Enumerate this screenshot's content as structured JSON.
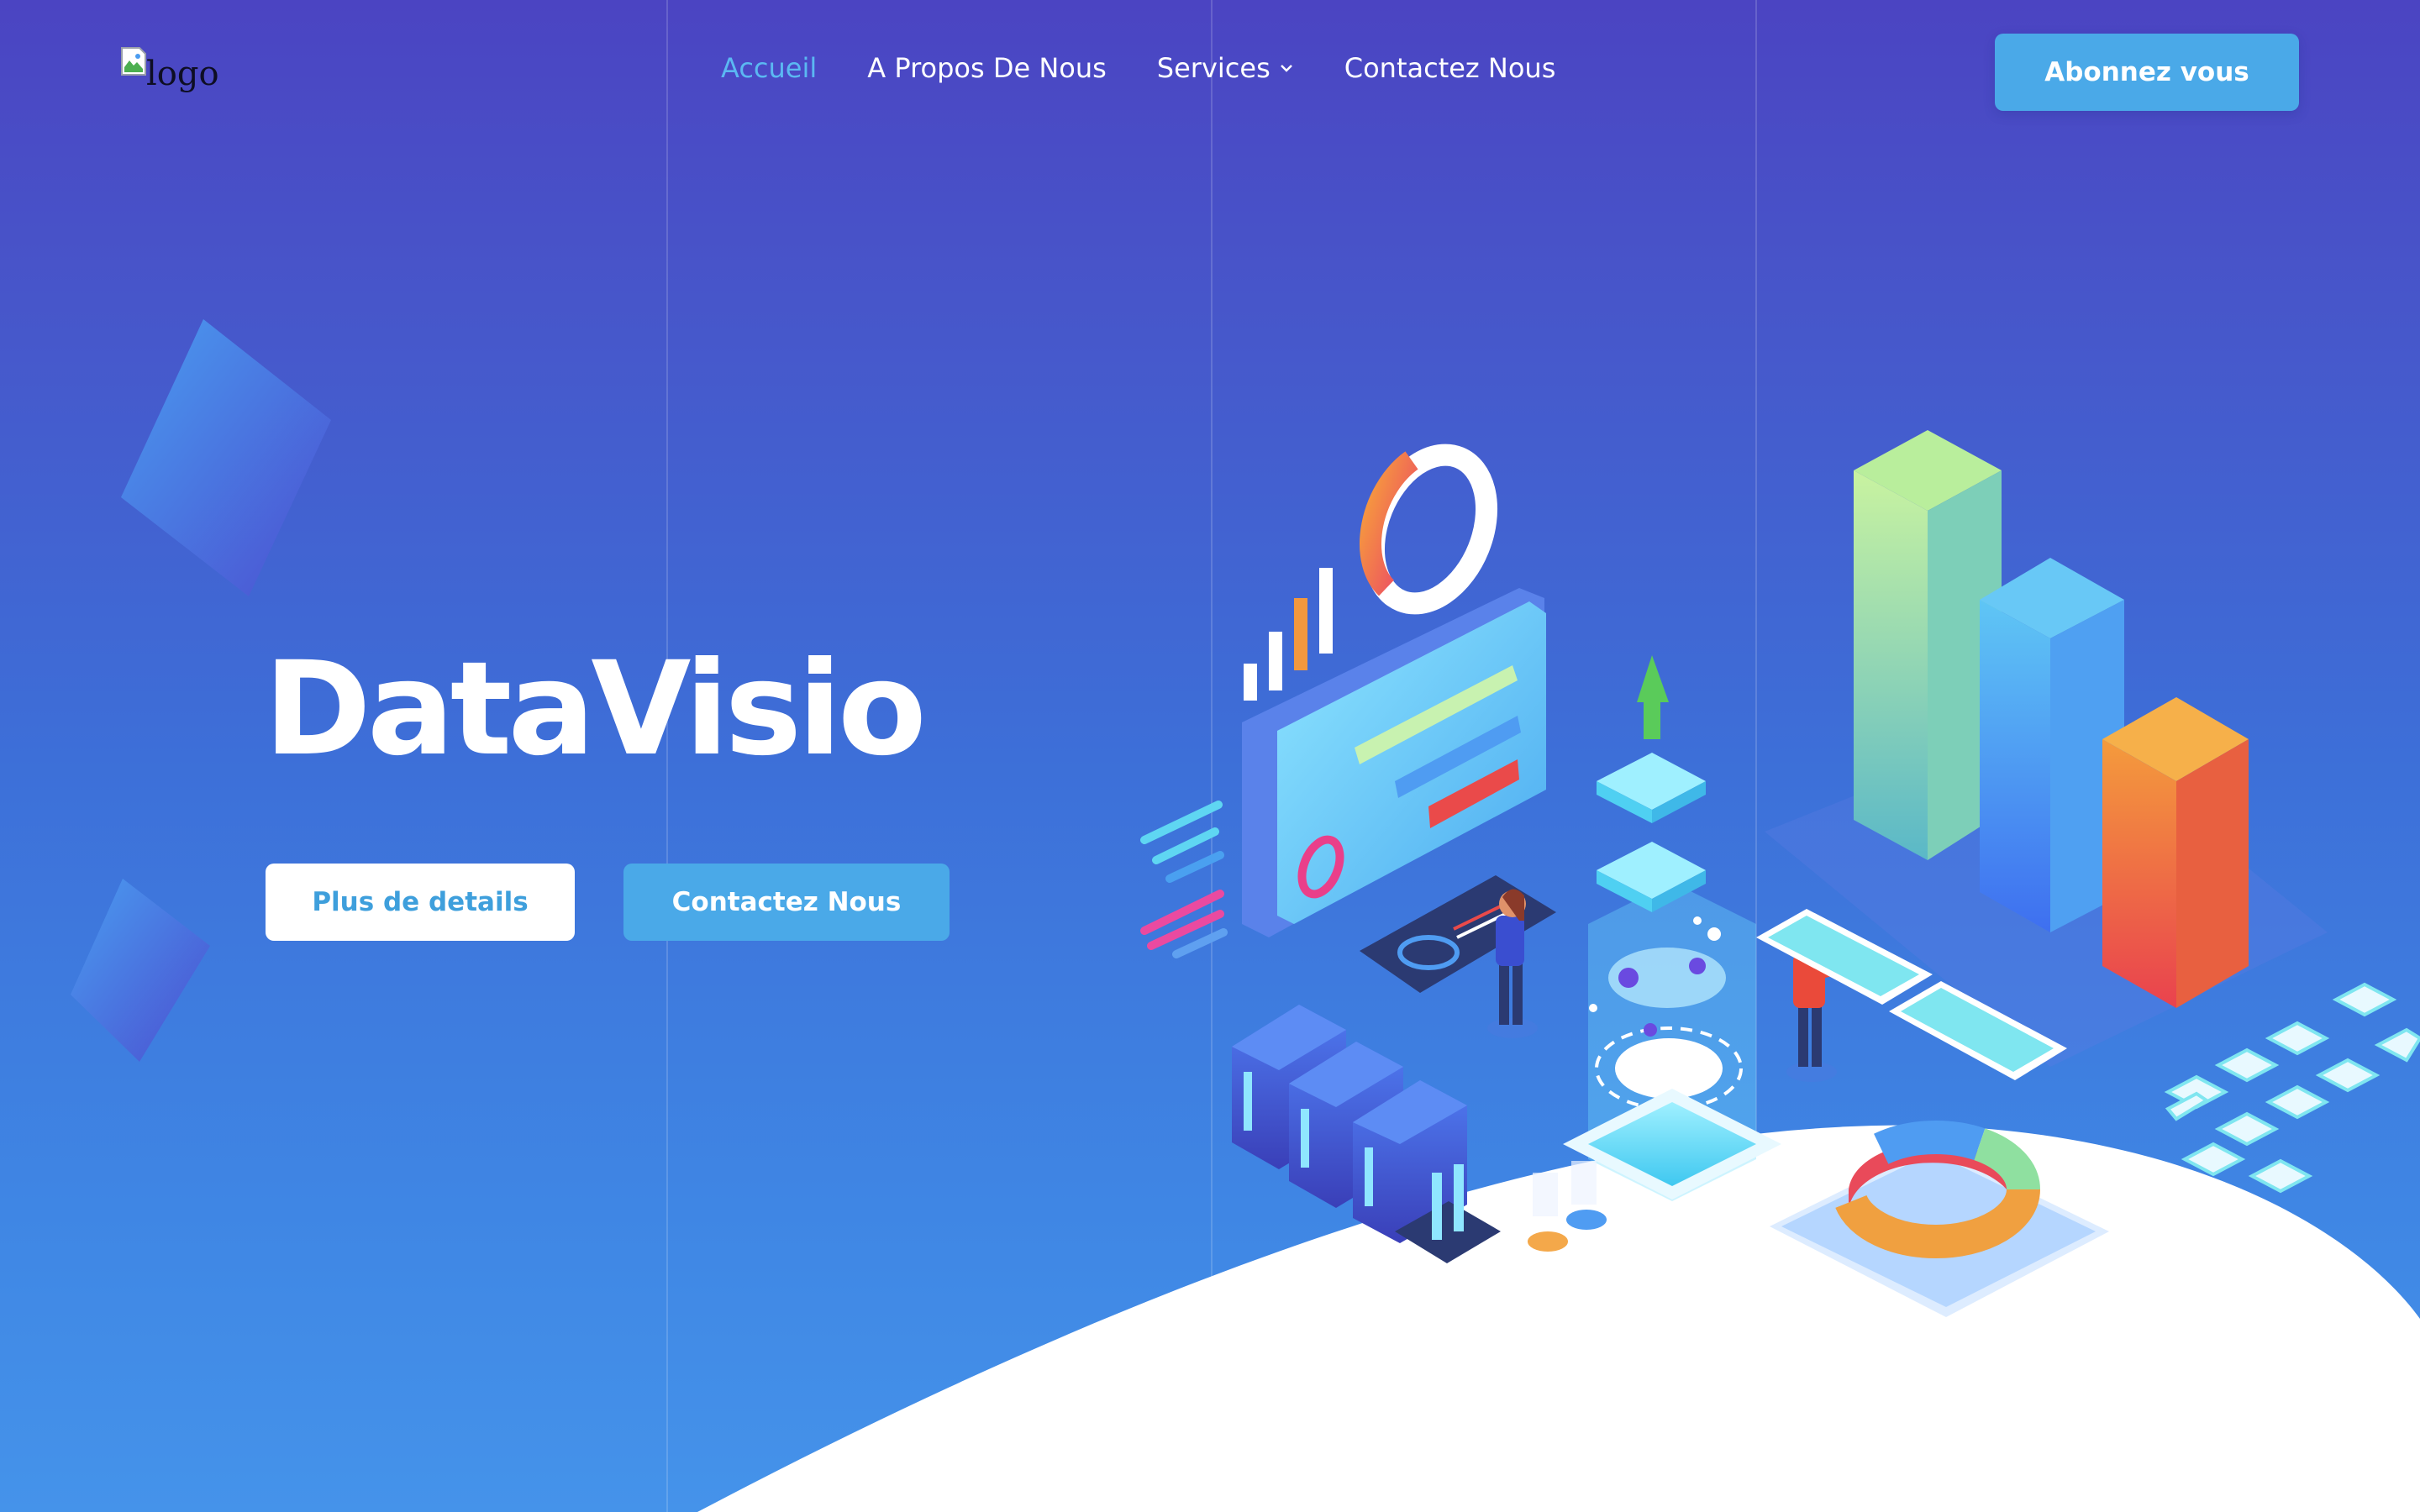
{
  "header": {
    "logo_alt": "logo",
    "nav": [
      {
        "label": "Accueil",
        "active": true
      },
      {
        "label": "A Propos De Nous",
        "active": false
      },
      {
        "label": "Services",
        "active": false,
        "has_dropdown": true
      },
      {
        "label": "Contactez Nous",
        "active": false
      }
    ],
    "subscribe_label": "Abonnez vous"
  },
  "hero": {
    "title": "DataVisio",
    "details_label": "Plus de details",
    "contact_label": "Contactez Nous"
  },
  "icons": {
    "logo": "broken-image-icon",
    "services_dropdown": "chevron-down-icon"
  },
  "colors": {
    "accent": "#4aa9e8",
    "active_nav": "#5bb8f2",
    "gradient_top": "#4b44c2",
    "gradient_bottom": "#4593ea"
  }
}
